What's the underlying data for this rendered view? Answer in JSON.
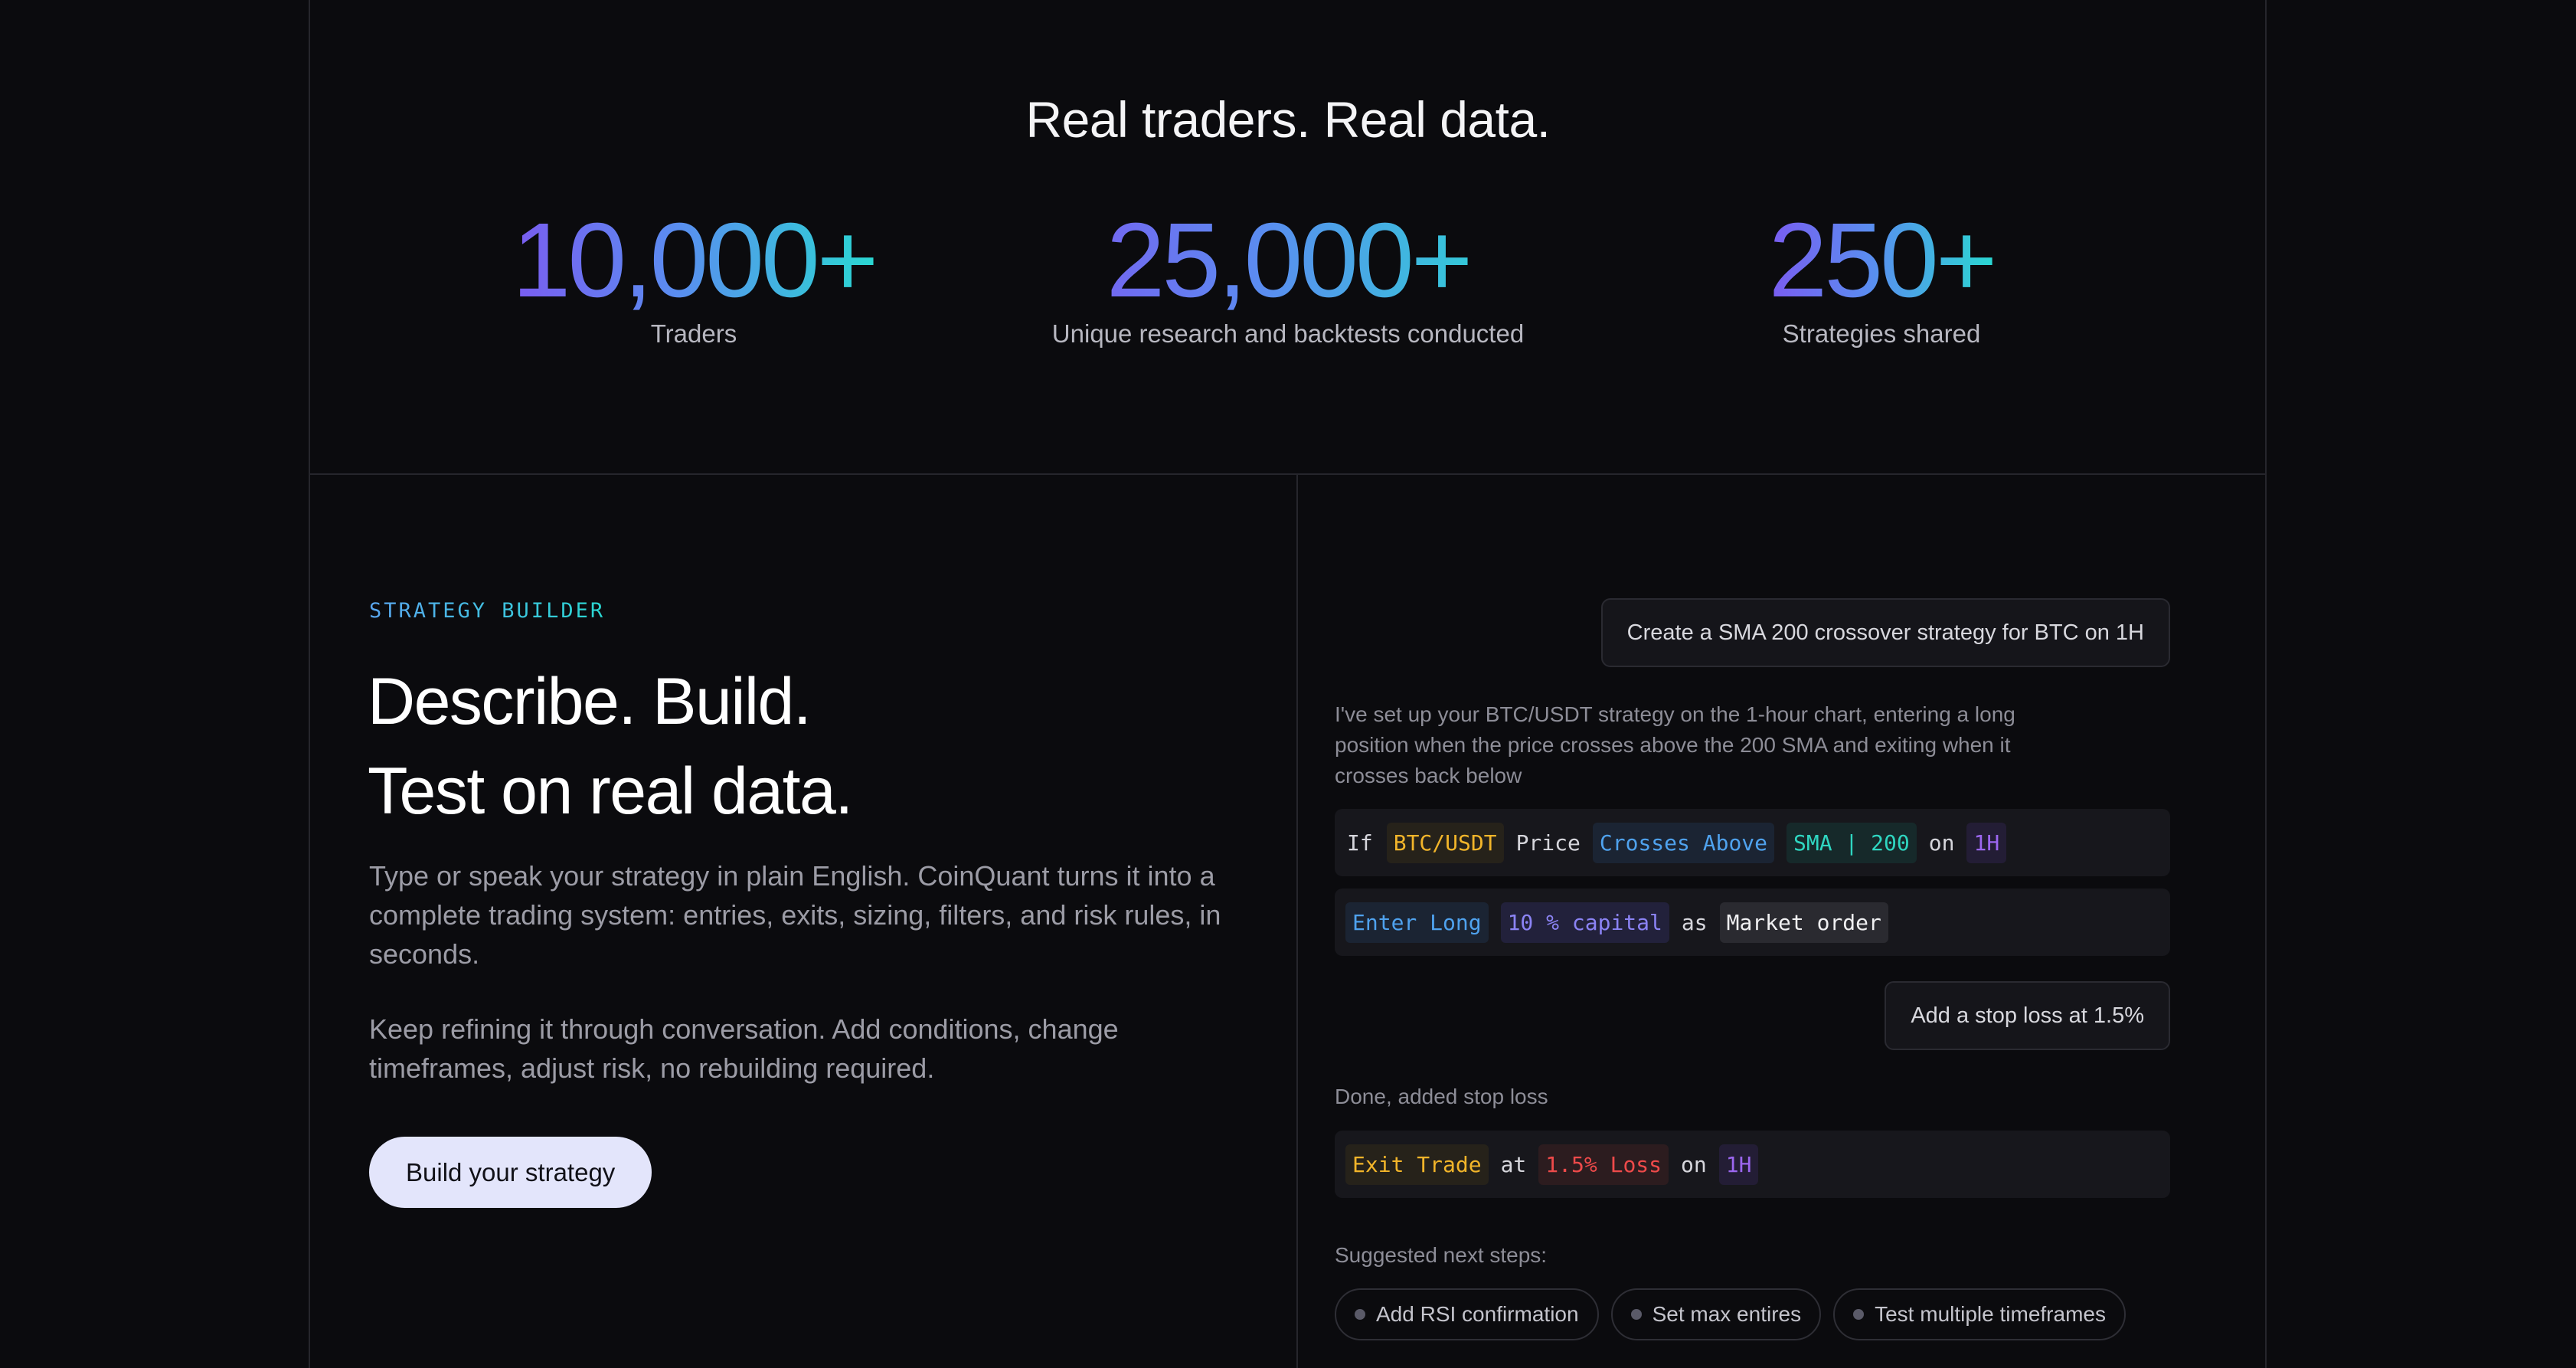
{
  "stats": {
    "title": "Real traders. Real data.",
    "items": [
      {
        "value": "10,000+",
        "label": "Traders"
      },
      {
        "value": "25,000+",
        "label": "Unique research and backtests conducted"
      },
      {
        "value": "250+",
        "label": "Strategies shared"
      }
    ]
  },
  "builder": {
    "eyebrow": "STRATEGY BUILDER",
    "headline_line1": "Describe. Build.",
    "headline_line2": "Test on real data.",
    "paragraph1": "Type or speak your strategy in plain English. CoinQuant turns it into a complete trading system: entries, exits, sizing, filters, and risk rules, in seconds.",
    "paragraph2": "Keep refining it through conversation. Add conditions, change timeframes, adjust risk, no rebuilding required.",
    "cta_label": "Build your strategy"
  },
  "chat": {
    "user_message_1": "Create a SMA 200 crossover strategy for BTC on 1H",
    "bot_message_1": "I've set up your BTC/USDT strategy on the 1-hour chart, entering a long position when the price crosses above the 200 SMA and exiting when it crosses back below",
    "rule_entry": {
      "if": "If",
      "pair": "BTC/USDT",
      "price": "Price",
      "condition": "Crosses Above",
      "indicator": "SMA | 200",
      "on": "on",
      "timeframe": "1H"
    },
    "rule_action": {
      "action": "Enter Long",
      "size": "10 % capital",
      "as": "as",
      "order_type": "Market order"
    },
    "user_message_2": "Add a stop loss at 1.5%",
    "bot_message_2": "Done, added stop loss",
    "rule_exit": {
      "action": "Exit Trade",
      "at": "at",
      "loss": "1.5% Loss",
      "on": "on",
      "timeframe": "1H"
    },
    "suggested_label": "Suggested next steps:",
    "suggestions": [
      "Add RSI confirmation",
      "Set max entires",
      "Test multiple timeframes"
    ]
  },
  "colors": {
    "background": "#0b0b0e",
    "gradient_start": "#7a5cf0",
    "gradient_end": "#2ad8d2",
    "cta_background": "#e3e5fb"
  }
}
